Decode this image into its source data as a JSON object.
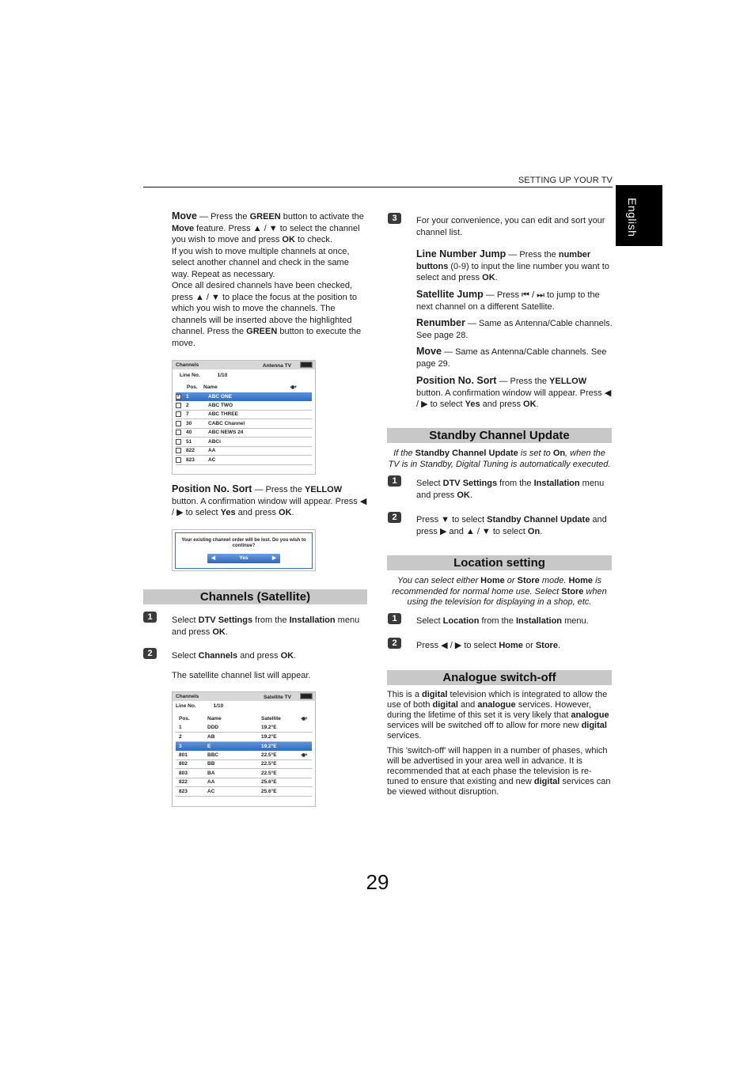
{
  "header": {
    "running_head": "SETTING UP YOUR TV",
    "language_tab": "English"
  },
  "left": {
    "move": {
      "term": "Move",
      "p1_a": " — Press the ",
      "green": "GREEN",
      "p1_b": " button to activate the ",
      "move_bold": "Move",
      "p1_c": " feature. Press ▲ / ▼ to select the channel you wish to move and press ",
      "ok": "OK",
      "p1_d": " to check.",
      "p2": "If you wish to move multiple channels at once, select another channel and check in the same way. Repeat as necessary.",
      "p3_a": "Once all desired channels have been checked, press ▲ / ▼ to place the focus at the position to which you wish to move the channels. The channels will be inserted above the highlighted channel. Press the ",
      "p3_green": "GREEN",
      "p3_b": " button to execute the move."
    },
    "antenna_screen": {
      "title": "Channels",
      "source": "Antenna TV",
      "line_no_label": "Line No.",
      "line_no_value": "1/10",
      "col_pos": "Pos.",
      "col_name": "Name",
      "rows": [
        {
          "pos": "1",
          "name": "ABC ONE",
          "checked": true,
          "selected": true
        },
        {
          "pos": "2",
          "name": "ABC TWO",
          "checked": false,
          "selected": false
        },
        {
          "pos": "7",
          "name": "ABC THREE",
          "checked": false,
          "selected": false
        },
        {
          "pos": "30",
          "name": "CABC Channel",
          "checked": false,
          "selected": false
        },
        {
          "pos": "40",
          "name": "ABC NEWS 24",
          "checked": false,
          "selected": false
        },
        {
          "pos": "51",
          "name": "ABCi",
          "checked": false,
          "selected": false
        },
        {
          "pos": "822",
          "name": "AA",
          "checked": false,
          "selected": false
        },
        {
          "pos": "823",
          "name": "AC",
          "checked": false,
          "selected": false
        }
      ]
    },
    "position_sort": {
      "term": "Position No. Sort",
      "a": " — Press the ",
      "yellow": "YELLOW",
      "b": " button. A confirmation window will appear. Press ◀ / ▶ to select ",
      "yes": "Yes",
      "c": " and press ",
      "ok": "OK",
      "d": "."
    },
    "confirm_dialog": {
      "message": "Your existing channel order will be lost. Do you wish to continue?",
      "option": "Yes",
      "left_arrow": "◀",
      "right_arrow": "▶"
    },
    "satellite_section": {
      "title": "Channels (Satellite)",
      "step1_a": "Select ",
      "step1_dtv": "DTV Settings",
      "step1_b": " from the ",
      "step1_inst": "Installation",
      "step1_c": " menu and press ",
      "step1_ok": "OK",
      "step1_d": ".",
      "step2_a": "Select ",
      "step2_ch": "Channels",
      "step2_b": " and press ",
      "step2_ok": "OK",
      "step2_c": ".",
      "step2_note": "The satellite channel list will appear."
    },
    "satellite_screen": {
      "title": "Channels",
      "source": "Satellite TV",
      "line_no_label": "Line No.",
      "line_no_value": "1/10",
      "col_pos": "Pos.",
      "col_name": "Name",
      "col_sat": "Satellite",
      "rows": [
        {
          "pos": "1",
          "name": "DDD",
          "sat": "19.2°E",
          "selected": false
        },
        {
          "pos": "2",
          "name": "AB",
          "sat": "19.2°E",
          "selected": false
        },
        {
          "pos": "3",
          "name": "E",
          "sat": "19.2°E",
          "selected": true
        },
        {
          "pos": "801",
          "name": "BBC",
          "sat": "22.5°E",
          "selected": false
        },
        {
          "pos": "802",
          "name": "BB",
          "sat": "22.5°E",
          "selected": false
        },
        {
          "pos": "803",
          "name": "BA",
          "sat": "22.5°E",
          "selected": false
        },
        {
          "pos": "822",
          "name": "AA",
          "sat": "25.6°E",
          "selected": false
        },
        {
          "pos": "823",
          "name": "AC",
          "sat": "25.6°E",
          "selected": false
        }
      ]
    }
  },
  "right": {
    "step3": "For your convenience, you can edit and sort your channel list.",
    "line_jump": {
      "term": "Line Number Jump",
      "a": " — Press the ",
      "b1": "number buttons",
      "c": " (0-9) to input the line number you want to select and press ",
      "ok": "OK",
      "d": "."
    },
    "sat_jump": {
      "term": "Satellite Jump",
      "a": " — Press ⏮ / ⏭ to jump to the next channel on a different Satellite."
    },
    "renumber": {
      "term": "Renumber",
      "a": " — Same as Antenna/Cable channels. See page 28."
    },
    "move": {
      "term": "Move",
      "a": " — Same as Antenna/Cable channels. See page 29."
    },
    "pos_sort": {
      "term": "Position No. Sort",
      "a": " — Press the ",
      "yellow": "YELLOW",
      "b": " button. A confirmation window will appear. Press ◀ / ▶ to select ",
      "yes": "Yes",
      "c": " and press ",
      "ok": "OK",
      "d": "."
    },
    "standby": {
      "title": "Standby Channel Update",
      "intro_a": "If the ",
      "intro_b": "Standby Channel Update",
      "intro_c": " is set to ",
      "intro_on": "On",
      "intro_d": ", when the TV is in Standby, Digital Tuning is automatically executed.",
      "s1_a": "Select ",
      "s1_dtv": "DTV Settings",
      "s1_b": " from the ",
      "s1_inst": "Installation",
      "s1_c": " menu and press ",
      "s1_ok": "OK",
      "s1_d": ".",
      "s2_a": "Press ▼ to select ",
      "s2_b": "Standby Channel Update",
      "s2_c": " and press ▶ and ▲ / ▼ to select ",
      "s2_on": "On",
      "s2_d": "."
    },
    "location": {
      "title": "Location setting",
      "intro_a": "You can select either ",
      "home": "Home",
      "intro_b": " or ",
      "store": "Store",
      "intro_c": " mode. ",
      "home2": "Home",
      "intro_d": " is recommended for normal home use. Select ",
      "store2": "Store",
      "intro_e": " when using the television for displaying in a shop, etc.",
      "s1_a": "Select ",
      "s1_loc": "Location",
      "s1_b": " from the ",
      "s1_inst": "Installation",
      "s1_c": " menu.",
      "s2_a": "Press ◀ / ▶ to select ",
      "s2_home": "Home",
      "s2_b": " or ",
      "s2_store": "Store",
      "s2_c": "."
    },
    "analogue": {
      "title": "Analogue switch-off",
      "p1_a": "This is a ",
      "digital1": "digital",
      "p1_b": " television which is integrated to allow the use of both ",
      "digital2": "digital",
      "p1_c": " and ",
      "analogue1": "analogue",
      "p1_d": " services. However, during the lifetime of this set it is very likely that ",
      "analogue2": "analogue",
      "p1_e": " services will be switched off to allow for more new ",
      "digital3": "digital",
      "p1_f": " services.",
      "p2_a": "This 'switch-off' will happen in a number of phases, which will be advertised in your area well in advance. It is recommended that at each phase the television is re-tuned to ensure that existing and new ",
      "digital4": "digital",
      "p2_b": " services can be viewed without disruption."
    }
  },
  "badges": {
    "one": "1",
    "two": "2",
    "three": "3"
  },
  "footer": {
    "page_number": "29"
  }
}
